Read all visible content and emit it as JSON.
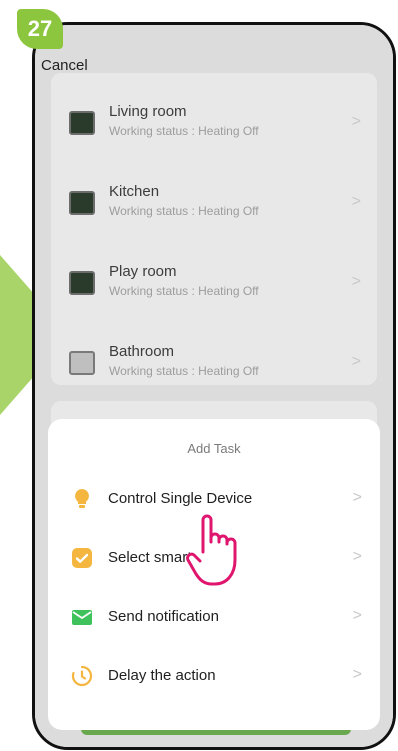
{
  "step_badge": "27",
  "header": {
    "cancel_label": "Cancel"
  },
  "rooms": [
    {
      "name": "Living room",
      "status": "Working status : Heating Off"
    },
    {
      "name": "Kitchen",
      "status": "Working status : Heating Off"
    },
    {
      "name": "Play room",
      "status": "Working status : Heating Off"
    },
    {
      "name": "Bathroom",
      "status": "Working status : Heating Off"
    }
  ],
  "sheet": {
    "title": "Add Task",
    "items": [
      {
        "label": "Control Single Device",
        "icon": "lightbulb-icon"
      },
      {
        "label": "Select smart",
        "icon": "checkbox-icon"
      },
      {
        "label": "Send notification",
        "icon": "mail-icon"
      },
      {
        "label": "Delay the action",
        "icon": "clock-icon"
      }
    ]
  },
  "chevron": ">",
  "colors": {
    "badge": "#8cc63f",
    "accent_yellow": "#f4b63f",
    "accent_green": "#3fc25c",
    "hand": "#e0156e"
  }
}
